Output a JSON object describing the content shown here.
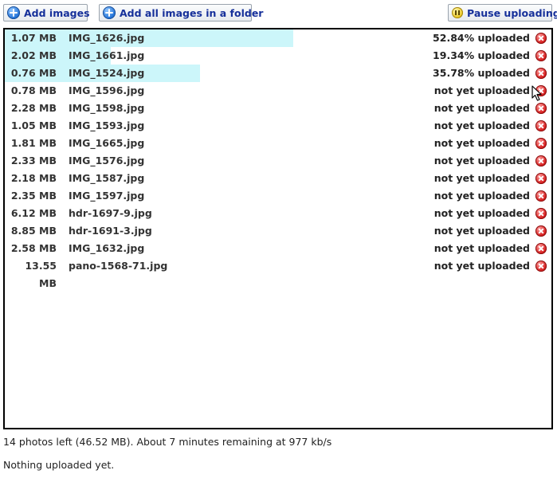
{
  "toolbar": {
    "add_images_label": "Add images",
    "add_folder_label": "Add all images in a folder",
    "pause_label": "Pause uploading"
  },
  "files": [
    {
      "size": "1.07 MB",
      "name": "IMG_1626.jpg",
      "status": "52.84% uploaded",
      "progress": 0.5284
    },
    {
      "size": "2.02 MB",
      "name": "IMG_1661.jpg",
      "status": "19.34% uploaded",
      "progress": 0.1934
    },
    {
      "size": "0.76 MB",
      "name": "IMG_1524.jpg",
      "status": "35.78% uploaded",
      "progress": 0.3578
    },
    {
      "size": "0.78 MB",
      "name": "IMG_1596.jpg",
      "status": "not yet uploaded",
      "progress": 0
    },
    {
      "size": "2.28 MB",
      "name": "IMG_1598.jpg",
      "status": "not yet uploaded",
      "progress": 0
    },
    {
      "size": "1.05 MB",
      "name": "IMG_1593.jpg",
      "status": "not yet uploaded",
      "progress": 0
    },
    {
      "size": "1.81 MB",
      "name": "IMG_1665.jpg",
      "status": "not yet uploaded",
      "progress": 0
    },
    {
      "size": "2.33 MB",
      "name": "IMG_1576.jpg",
      "status": "not yet uploaded",
      "progress": 0
    },
    {
      "size": "2.18 MB",
      "name": "IMG_1587.jpg",
      "status": "not yet uploaded",
      "progress": 0
    },
    {
      "size": "2.35 MB",
      "name": "IMG_1597.jpg",
      "status": "not yet uploaded",
      "progress": 0
    },
    {
      "size": "6.12 MB",
      "name": "hdr-1697-9.jpg",
      "status": "not yet uploaded",
      "progress": 0
    },
    {
      "size": "8.85 MB",
      "name": "hdr-1691-3.jpg",
      "status": "not yet uploaded",
      "progress": 0
    },
    {
      "size": "2.58 MB",
      "name": "IMG_1632.jpg",
      "status": "not yet uploaded",
      "progress": 0
    },
    {
      "size": "13.55 MB",
      "name": "pano-1568-71.jpg",
      "status": "not yet uploaded",
      "progress": 0
    }
  ],
  "summary": "14 photos left (46.52 MB).  About 7 minutes remaining at 977 kb/s",
  "upload_status": "Nothing uploaded yet.",
  "colors": {
    "progress_fill": "#ccf6fa",
    "button_text": "#16309a",
    "remove_icon": "#d71f1f"
  }
}
